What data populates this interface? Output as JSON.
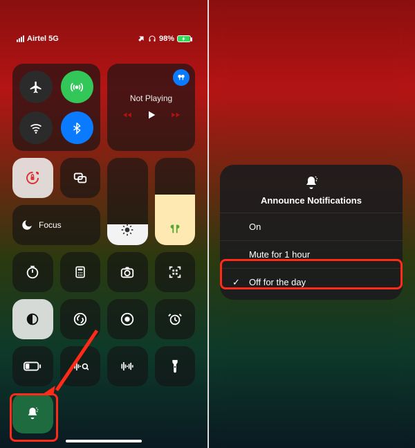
{
  "status": {
    "carrier": "Airtel 5G",
    "battery_text": "98%"
  },
  "connectivity": {
    "airplane": "airplane-icon",
    "cellular": "cellular-icon",
    "wifi": "wifi-icon",
    "bluetooth": "bluetooth-icon"
  },
  "music": {
    "title": "Not Playing"
  },
  "focus": {
    "label": "Focus"
  },
  "popup": {
    "title": "Announce Notifications",
    "options": [
      {
        "label": "On",
        "selected": false
      },
      {
        "label": "Mute for 1 hour",
        "selected": false
      },
      {
        "label": "Off for the day",
        "selected": true
      }
    ]
  }
}
